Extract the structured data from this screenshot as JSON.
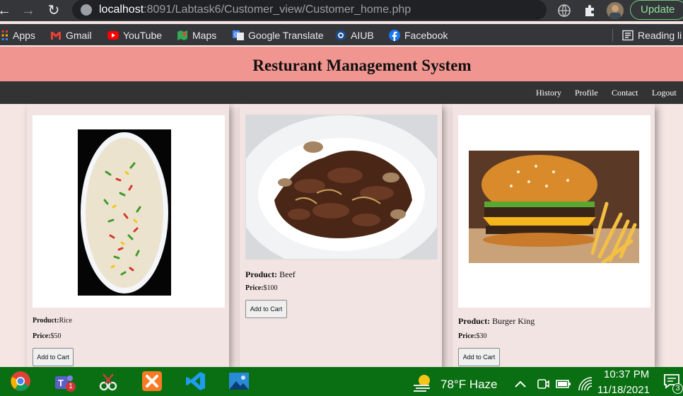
{
  "browser": {
    "url_host": "localhost",
    "url_path": ":8091/Labtask6/Customer_view/Customer_home.php",
    "update_label": "Update"
  },
  "bookmarks": [
    {
      "label": "Apps",
      "icon": "apps-grid-icon"
    },
    {
      "label": "Gmail",
      "icon": "gmail-icon"
    },
    {
      "label": "YouTube",
      "icon": "youtube-icon"
    },
    {
      "label": "Maps",
      "icon": "maps-icon"
    },
    {
      "label": "Google Translate",
      "icon": "google-translate-icon"
    },
    {
      "label": "AIUB",
      "icon": "aiub-icon"
    },
    {
      "label": "Facebook",
      "icon": "facebook-icon"
    }
  ],
  "reading_list": "Reading li",
  "page": {
    "title": "Resturant Management System",
    "nav": [
      "History",
      "Profile",
      "Contact",
      "Logout"
    ]
  },
  "products": [
    {
      "product_label": "Product:",
      "name": "Rice",
      "price_label": "Price:",
      "price": "$50",
      "button": "Add to Cart"
    },
    {
      "product_label": "Product:",
      "name": " Beef",
      "price_label": "Price:",
      "price": "$100",
      "button": "Add to Cart"
    },
    {
      "product_label": "Product:",
      "name": " Burger King",
      "price_label": "Price:",
      "price": "$30",
      "button": "Add to Cart"
    }
  ],
  "taskbar": {
    "weather": "78°F  Haze",
    "time": "10:37 PM",
    "date": "11/18/2021",
    "notification_count": "3",
    "teams_badge": "1"
  },
  "colors": {
    "header": "#f09590",
    "navbar": "#333333",
    "page_bg": "#f5e6e4",
    "taskbar": "#0a6e12"
  }
}
